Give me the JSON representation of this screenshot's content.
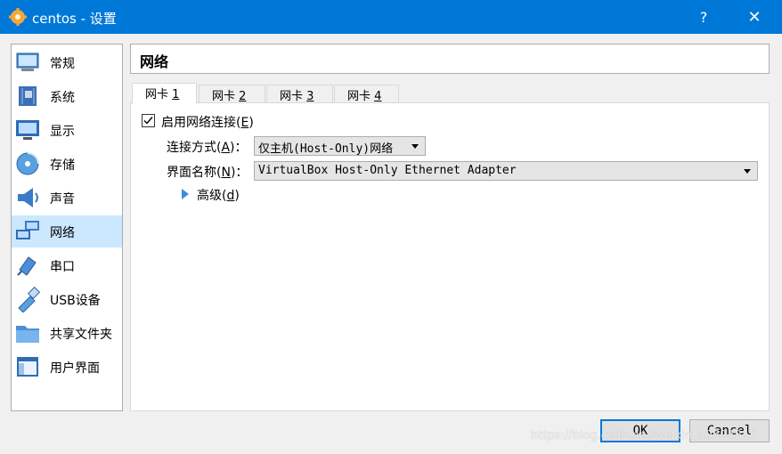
{
  "window": {
    "title": "centos - 设置",
    "help_label": "?",
    "close_label": "✕"
  },
  "sidebar": {
    "items": [
      {
        "label": "常规",
        "icon": "general-icon"
      },
      {
        "label": "系统",
        "icon": "system-icon"
      },
      {
        "label": "显示",
        "icon": "display-icon"
      },
      {
        "label": "存储",
        "icon": "storage-icon"
      },
      {
        "label": "声音",
        "icon": "audio-icon"
      },
      {
        "label": "网络",
        "icon": "network-icon",
        "selected": true
      },
      {
        "label": "串口",
        "icon": "serial-port-icon"
      },
      {
        "label": "USB设备",
        "icon": "usb-icon"
      },
      {
        "label": "共享文件夹",
        "icon": "shared-folder-icon"
      },
      {
        "label": "用户界面",
        "icon": "user-interface-icon"
      }
    ]
  },
  "header": {
    "title": "网络"
  },
  "tabs": [
    {
      "label": "网卡 ",
      "key": "1",
      "active": true
    },
    {
      "label": "网卡 ",
      "key": "2"
    },
    {
      "label": "网卡 ",
      "key": "3"
    },
    {
      "label": "网卡 ",
      "key": "4"
    }
  ],
  "adapter": {
    "enable_label": "启用网络连接(",
    "enable_key": "E",
    "enable_suffix": ")",
    "enabled": true,
    "attached_label": "连接方式(",
    "attached_key": "A",
    "attached_suffix": ")：",
    "attached_value": "仅主机(Host-Only)网络",
    "name_label": "界面名称(",
    "name_key": "N",
    "name_suffix": ")：",
    "name_value": "VirtualBox Host-Only Ethernet Adapter",
    "advanced_label": "高级(",
    "advanced_key": "d",
    "advanced_suffix": ")"
  },
  "buttons": {
    "ok": "OK",
    "cancel": "Cancel"
  },
  "watermark": "https://blog.csdn.net/weixin_40594815",
  "colors": {
    "accent": "#0078d7",
    "selection": "#cce8ff"
  }
}
